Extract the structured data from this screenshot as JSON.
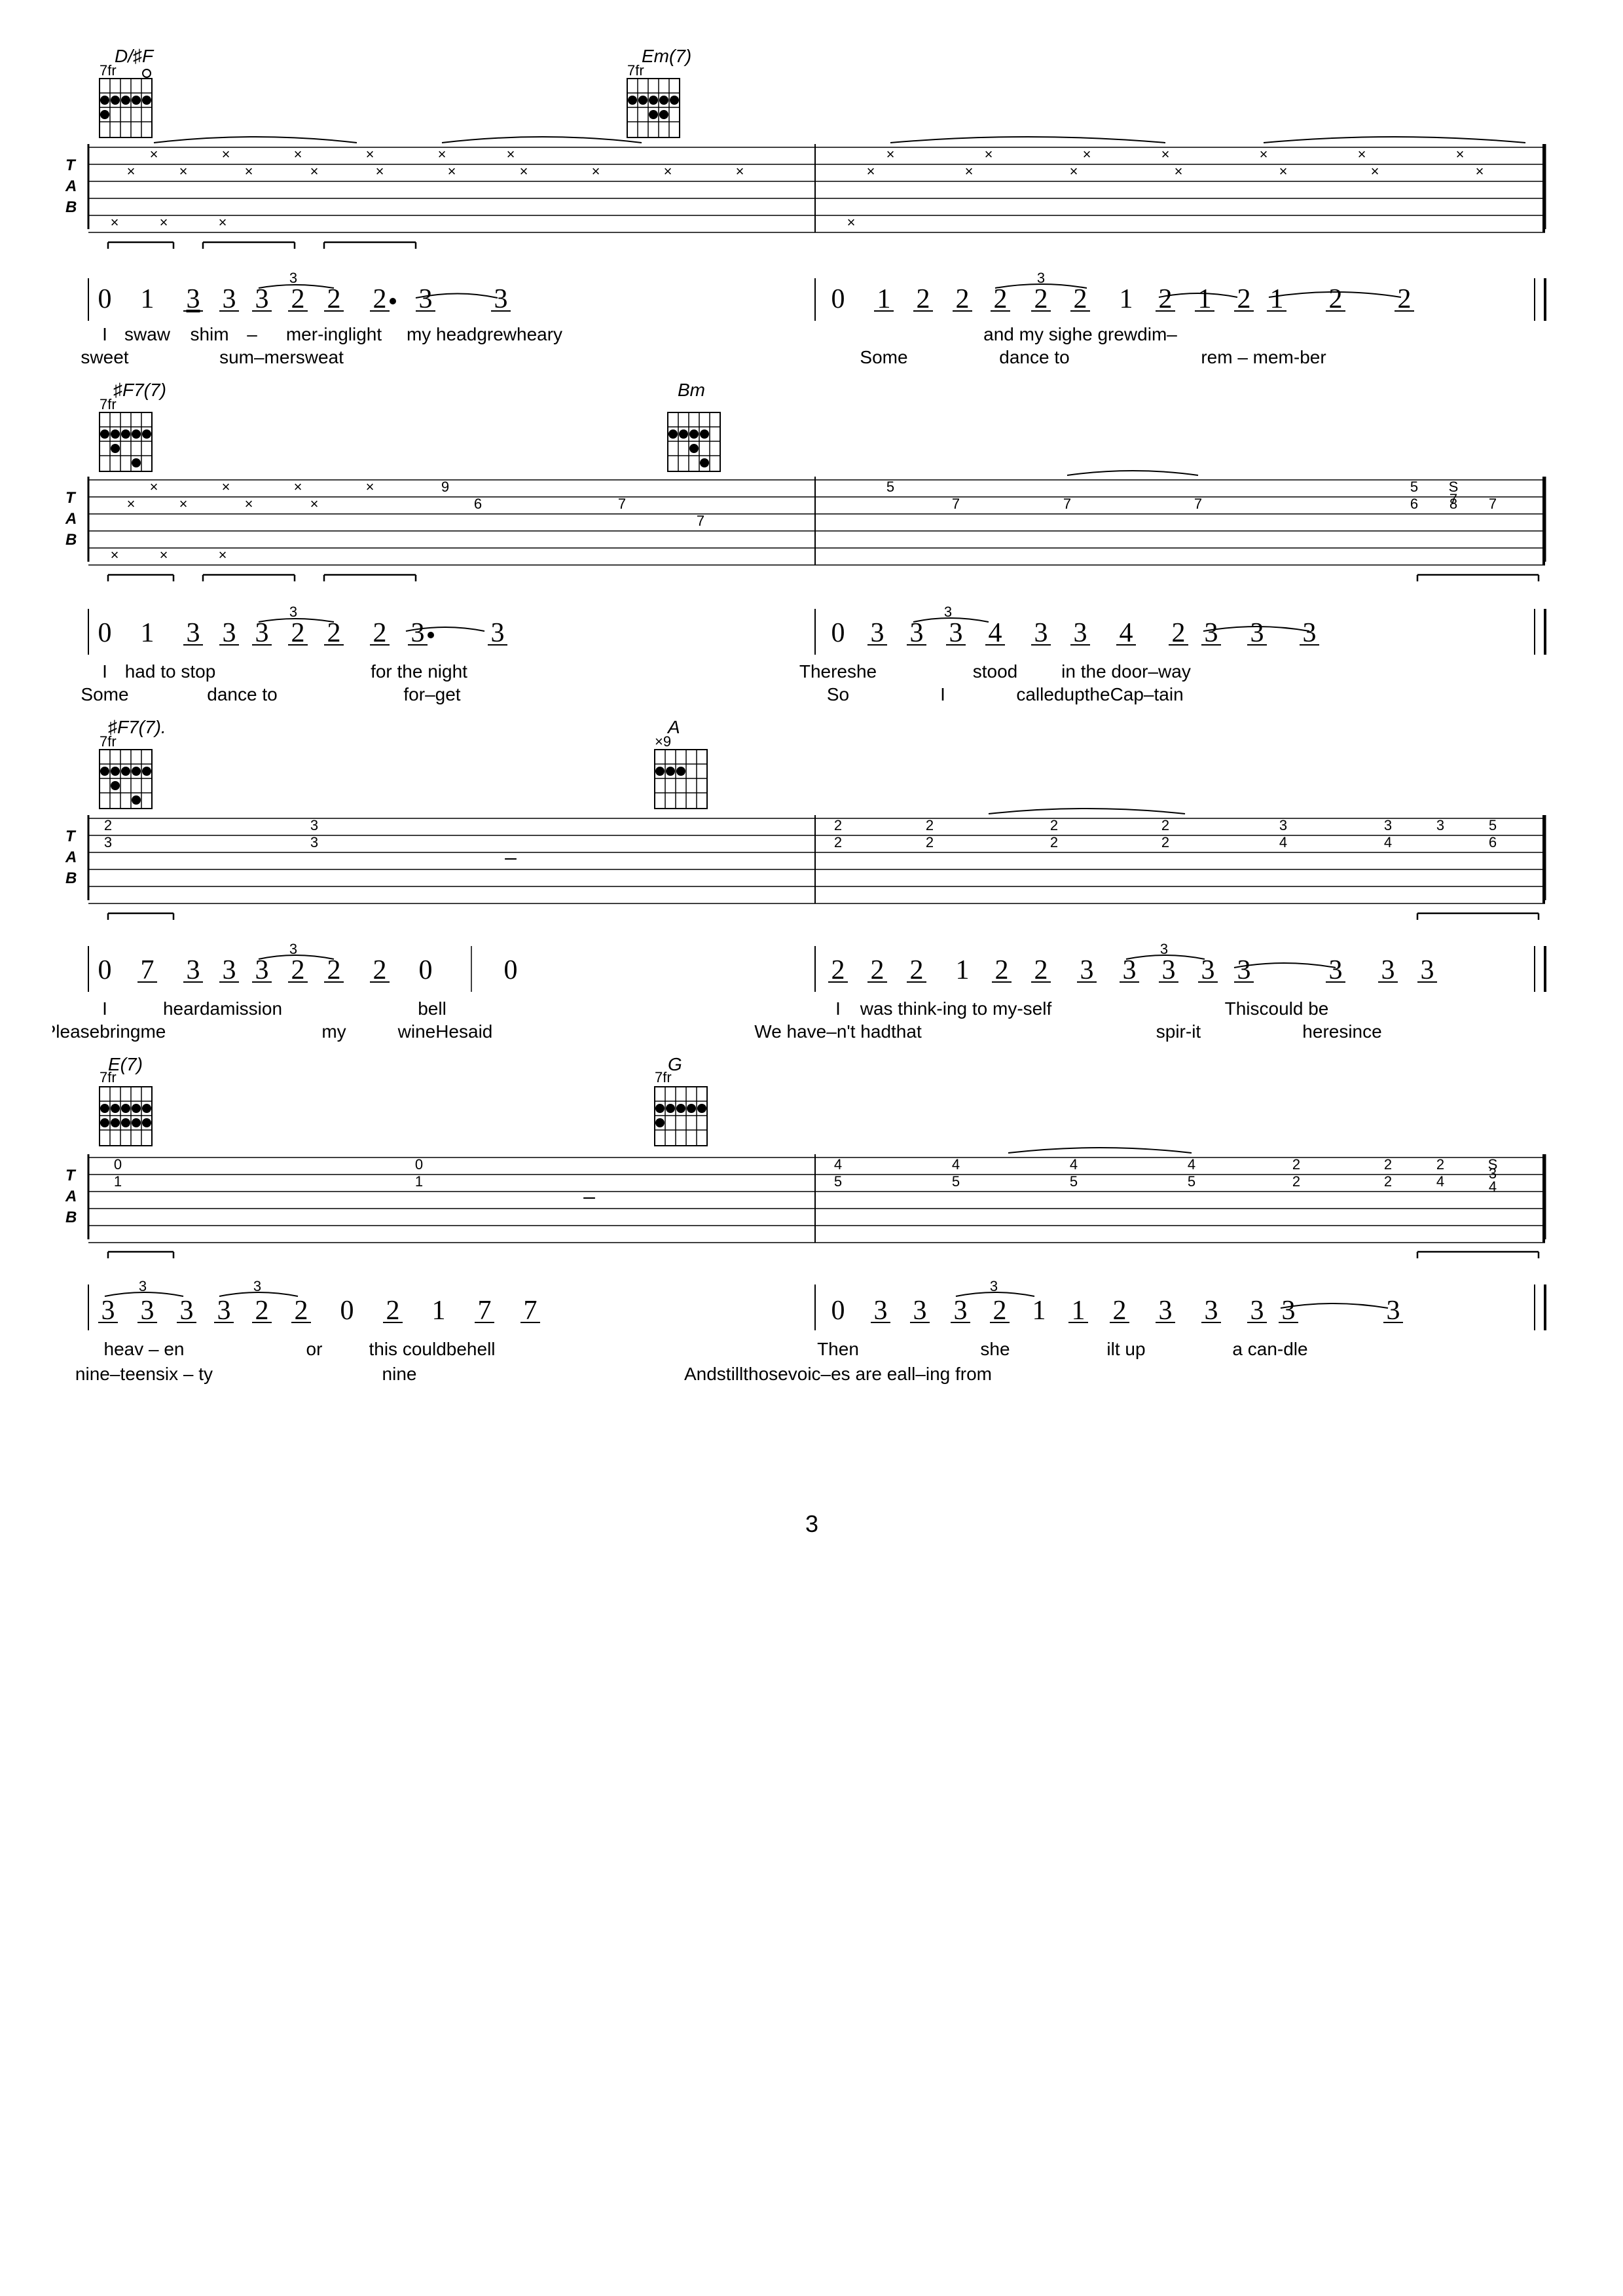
{
  "page": {
    "number": "3",
    "background": "#ffffff"
  },
  "sections": [
    {
      "id": "section1",
      "chords": [
        {
          "name": "D/♯F",
          "fret": "7",
          "position": "left"
        },
        {
          "name": "Em(7)",
          "fret": "7",
          "position": "right"
        }
      ],
      "tab": {
        "strings": [
          "T",
          "A",
          "B"
        ],
        "notes": "x marks and fret numbers"
      },
      "notation": {
        "measures": [
          {
            "notes": [
              "0",
              "1",
              "3̲",
              "3̲",
              "3̲2̲2̲",
              "2•",
              "3̲",
              "3̲"
            ],
            "lyrics1": [
              "I",
              "swaw",
              "shim",
              "–",
              "mer-inglight",
              "",
              "my headgrewheary",
              "",
              "and my sighe grewdim–"
            ],
            "lyrics2": [
              "sweet",
              "",
              "sum–mersweat",
              "",
              "",
              "Some",
              "dance to",
              "rem – mem-ber"
            ]
          },
          {
            "notes": [
              "0",
              "1̲",
              "2̲",
              "2̲",
              "2̲2̲2̲",
              "1",
              "2̲",
              "1̲",
              "2̲",
              "2̲"
            ],
            "lyrics1": [],
            "lyrics2": []
          }
        ]
      }
    },
    {
      "id": "section2",
      "chords": [
        {
          "name": "♯F7(7)",
          "fret": "7",
          "position": "left"
        },
        {
          "name": "Bm",
          "fret": "",
          "position": "right"
        }
      ]
    },
    {
      "id": "section3",
      "chords": [
        {
          "name": "♯F7(7)",
          "fret": "7",
          "position": "left"
        },
        {
          "name": "A",
          "fret": "x9",
          "position": "right"
        }
      ]
    },
    {
      "id": "section4",
      "chords": [
        {
          "name": "E(7)",
          "fret": "7",
          "position": "left"
        },
        {
          "name": "G",
          "fret": "7",
          "position": "right"
        }
      ]
    }
  ]
}
